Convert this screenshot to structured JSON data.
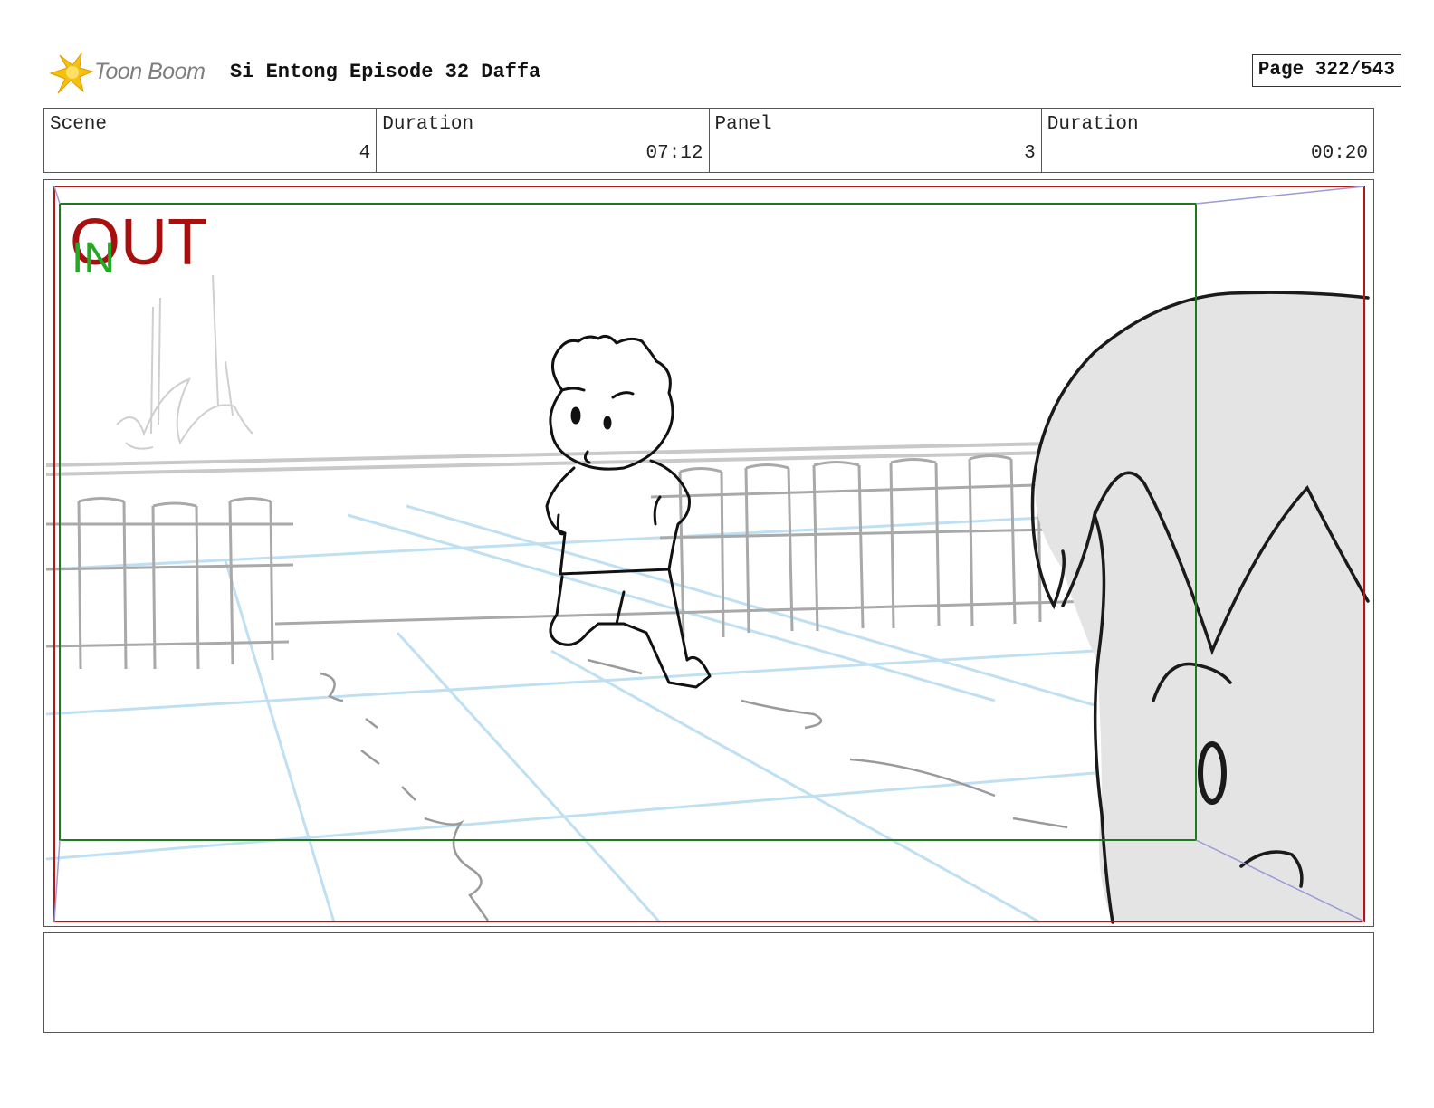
{
  "header": {
    "logo_text": "Toon Boom",
    "title": "Si Entong Episode 32 Daffa",
    "page": "Page 322/543"
  },
  "info": {
    "scene_label": "Scene",
    "scene_value": "4",
    "scene_duration_label": "Duration",
    "scene_duration_value": "07:12",
    "panel_label": "Panel",
    "panel_value": "3",
    "panel_duration_label": "Duration",
    "panel_duration_value": "00:20"
  },
  "panel": {
    "out_label": "OUT",
    "in_label": "IN",
    "colors": {
      "out_frame": "#b01818",
      "in_frame": "#1f7a1f",
      "out_text": "#a80f0f",
      "in_text": "#22aa22",
      "perspective": "#bfe0f2",
      "pencil": "#b0b0b0",
      "ink": "#111111",
      "foreground_fill": "#e4e4e4"
    }
  },
  "notes": {
    "text": ""
  }
}
